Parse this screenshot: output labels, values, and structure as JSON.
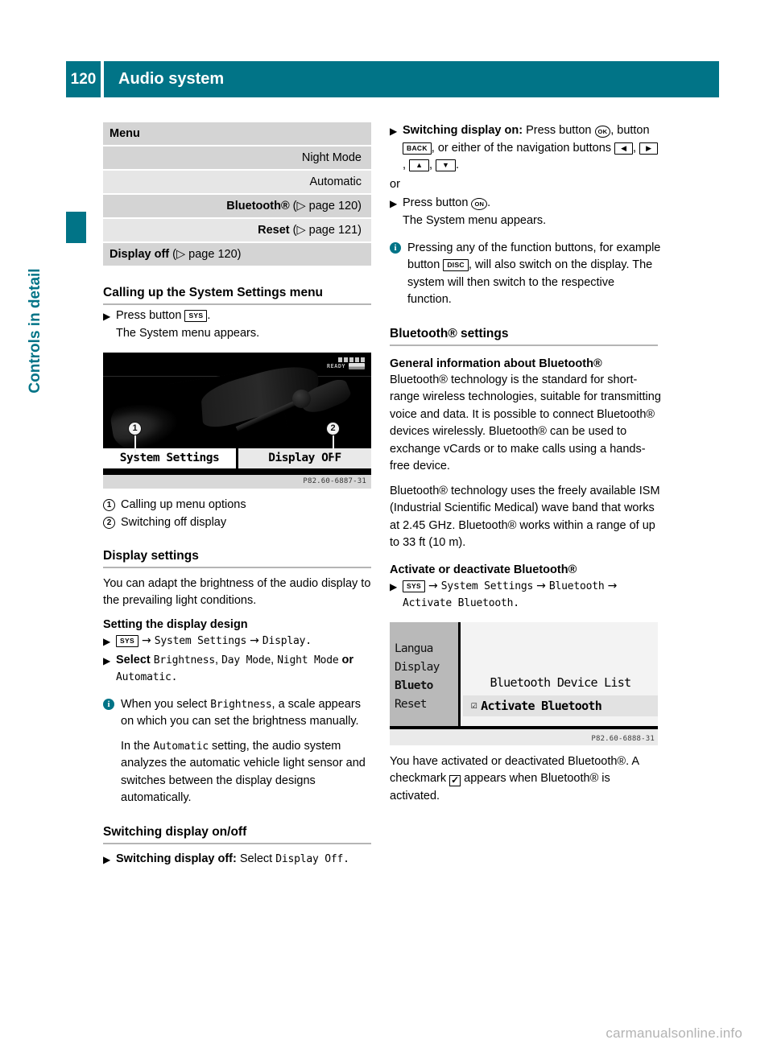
{
  "header": {
    "page_number": "120",
    "title": "Audio system"
  },
  "side_tab": {
    "chapter_label": "Controls in detail"
  },
  "left_column": {
    "menu_table": {
      "header_label": "Menu",
      "rows": [
        {
          "label": "Night Mode",
          "level": 1,
          "bold": false,
          "ref": ""
        },
        {
          "label": "Automatic",
          "level": 1,
          "bold": false,
          "ref": ""
        },
        {
          "label": "Bluetooth®",
          "level": 1,
          "bold": true,
          "ref": "(▷ page 120)"
        },
        {
          "label": "Reset",
          "level": 1,
          "bold": true,
          "ref": "(▷ page 121)"
        },
        {
          "label": "Display off",
          "level": 0,
          "bold": true,
          "ref": "(▷ page 120)"
        }
      ]
    },
    "calling_up_heading": "Calling up the System Settings menu",
    "press_button_prefix": "Press button",
    "sys_key": "SYS",
    "press_button_suffix": ".",
    "system_menu_appears": "The System menu appears.",
    "figure1": {
      "ready_text": "READY",
      "left_label": "System Settings",
      "right_label": "Display OFF",
      "credit": "P82.60-6887-31",
      "callout_1": "1",
      "callout_2": "2"
    },
    "legend": [
      {
        "num": "1",
        "text": "Calling up menu options"
      },
      {
        "num": "2",
        "text": "Switching off display"
      }
    ],
    "display_settings_heading": "Display settings",
    "display_settings_para": "You can adapt the brightness of the audio display to the prevailing light conditions.",
    "setting_design_heading": "Setting the display design",
    "path_line_1": "System Settings",
    "path_line_1b": "Display.",
    "select_prefix": "Select",
    "select_opt_1": "Brightness",
    "select_opt_2": "Day Mode",
    "select_opt_3": "Night Mode",
    "select_or": "or",
    "select_opt_4": "Automatic",
    "select_end": ".",
    "note": {
      "icon": "info-icon",
      "p1_a": "When you select",
      "p1_mono": "Brightness",
      "p1_b": ", a scale appears on which you can set the brightness manually.",
      "p2_a": "In the",
      "p2_mono": "Automatic",
      "p2_b": " setting, the audio system analyzes the automatic vehicle light sensor and switches between the display designs automatically."
    },
    "switching_heading": "Switching display on/off",
    "switch_off_bold": "Switching display off:",
    "switch_off_rest": "Select",
    "switch_off_mono": "Display Off",
    "switch_off_end": "."
  },
  "right_column": {
    "switch_on_bold": "Switching display on:",
    "switch_on_text_1": "Press button",
    "ok_key": "OK",
    "switch_on_text_2": "button",
    "back_key": "BACK",
    "switch_on_text_3": ", or either of the navigation buttons",
    "nav_keys": [
      "◀",
      "▶",
      "▲",
      "▼"
    ],
    "or_label": "or",
    "press_on_text": "Press button",
    "on_key": "ON",
    "system_menu_appears": "The System menu appears.",
    "note": {
      "icon": "info-icon",
      "text_a": "Pressing any of the function buttons, for example button",
      "disc_key": "DISC",
      "text_b": ", will also switch on the display. The system will then switch to the respective function."
    },
    "bluetooth_settings_heading": "Bluetooth® settings",
    "general_info_heading": "General information about Bluetooth®",
    "general_para_1": "Bluetooth® technology is the standard for short-range wireless technologies, suitable for transmitting voice and data. It is possible to connect Bluetooth® devices wirelessly. Bluetooth® can be used to exchange vCards or to make calls using a hands-free device.",
    "general_para_2": "Bluetooth® technology uses the freely available ISM (Industrial Scientific Medical) wave band that works at 2.45 GHz. Bluetooth® works within a range of up to 33 ft (10 m).",
    "activate_heading": "Activate or deactivate Bluetooth®",
    "activate_path_sys": "SYS",
    "activate_path_1": "System Settings",
    "activate_path_2": "Bluetooth",
    "activate_path_3": "Activate Bluetooth.",
    "figure2": {
      "sidebar_items": [
        "Langua",
        "Display",
        "Blueto",
        "Reset"
      ],
      "selected_index": 2,
      "device_list_label": "Bluetooth Device List",
      "activate_label": "Activate Bluetooth",
      "checkbox_glyph": "☑",
      "credit": "P82.60-6888-31"
    },
    "result_para_a": "You have activated or deactivated Bluetooth®. A checkmark",
    "result_para_b": "appears when Bluetooth® is activated."
  },
  "watermark": "carmanualsonline.info",
  "colors": {
    "teal": "#017487",
    "table_shade_dark": "#d4d4d4",
    "table_shade_light": "#e6e6e6",
    "rule": "#b5b5b5"
  }
}
